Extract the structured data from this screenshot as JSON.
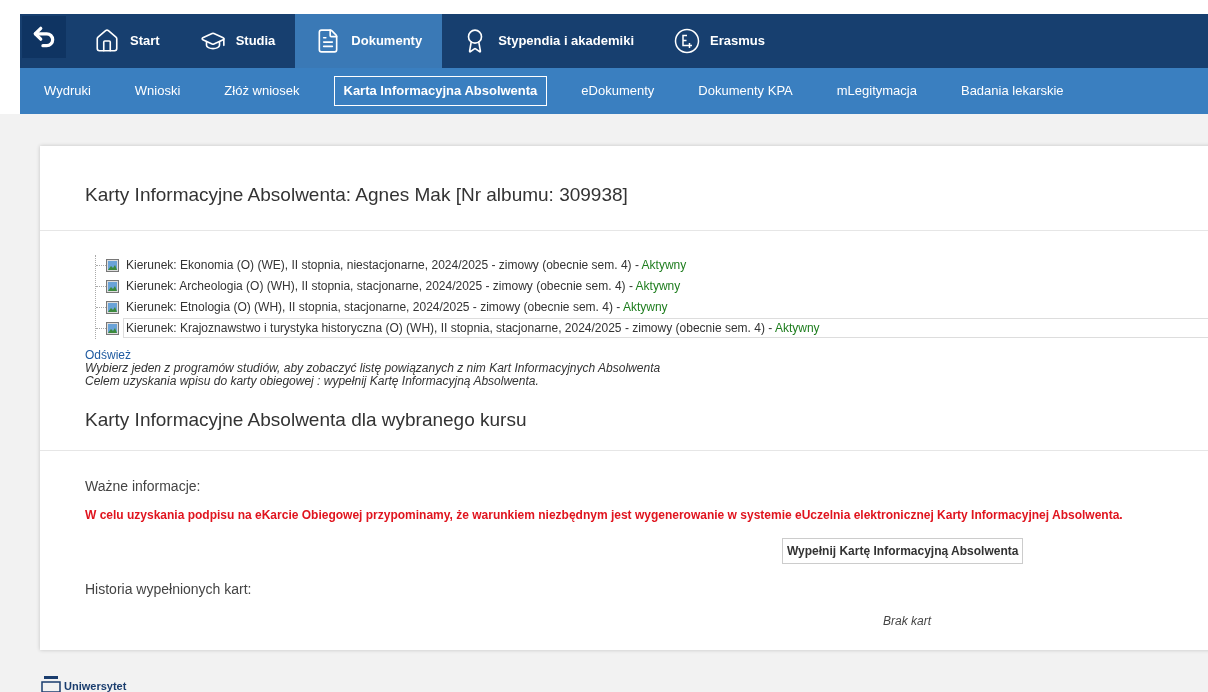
{
  "top_nav": [
    {
      "label": "Start",
      "selected": false
    },
    {
      "label": "Studia",
      "selected": false
    },
    {
      "label": "Dokumenty",
      "selected": true
    },
    {
      "label": "Stypendia i akademiki",
      "selected": false
    },
    {
      "label": "Erasmus",
      "selected": false
    }
  ],
  "sub_nav": [
    {
      "label": "Wydruki",
      "selected": false
    },
    {
      "label": "Wnioski",
      "selected": false
    },
    {
      "label": "Złóż wniosek",
      "selected": false
    },
    {
      "label": "Karta Informacyjna Absolwenta",
      "selected": true
    },
    {
      "label": "eDokumenty",
      "selected": false
    },
    {
      "label": "Dokumenty KPA",
      "selected": false
    },
    {
      "label": "mLegitymacja",
      "selected": false
    },
    {
      "label": "Badania lekarskie",
      "selected": false
    }
  ],
  "title": "Karty Informacyjne Absolwenta: Agnes Mak [Nr albumu: 309938]",
  "programs": [
    {
      "text": "Kierunek: Ekonomia (O) (WE), II stopnia, niestacjonarne, 2024/2025 - zimowy (obecnie sem. 4) - ",
      "status": "Aktywny",
      "selected": false
    },
    {
      "text": "Kierunek: Archeologia (O) (WH), II stopnia, stacjonarne, 2024/2025 - zimowy (obecnie sem. 4) - ",
      "status": "Aktywny",
      "selected": false
    },
    {
      "text": "Kierunek: Etnologia (O) (WH), II stopnia, stacjonarne, 2024/2025 - zimowy (obecnie sem. 4) - ",
      "status": "Aktywny",
      "selected": false
    },
    {
      "text": "Kierunek: Krajoznawstwo i turystyka historyczna (O) (WH), II stopnia, stacjonarne, 2024/2025 - zimowy (obecnie sem. 4) - ",
      "status": "Aktywny",
      "selected": true
    }
  ],
  "refresh_link": "Odśwież",
  "hints": [
    "Wybierz jeden z programów studiów, aby zobaczyć listę powiązanych z nim Kart Informacyjnych Absolwenta",
    "Celem uzyskania wpisu do karty obiegowej : wypełnij Kartę Informacyjną Absolwenta."
  ],
  "course_heading": "Karty Informacyjne Absolwenta dla wybranego kursu",
  "important_label": "Ważne informacje:",
  "warning": "W celu uzyskania podpisu na eKarcie Obiegowej przypominamy, że warunkiem niezbędnym jest wygenerowanie w systemie eUczelnia elektronicznej Karty Informacyjnej Absolwenta.",
  "fill_button": "Wypełnij Kartę Informacyjną Absolwenta",
  "history_label": "Historia wypełnionych kart:",
  "history_empty": "Brak kart",
  "footer_logo": "Uniwersytet"
}
